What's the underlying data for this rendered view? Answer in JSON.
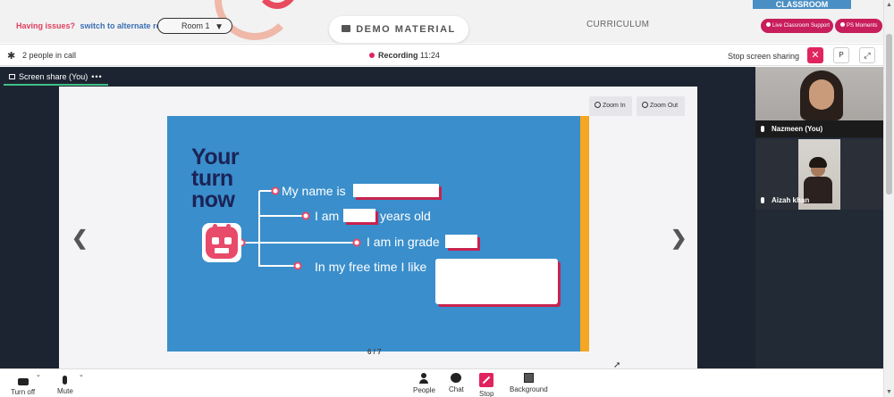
{
  "header": {
    "issues_text": "Having issues?",
    "switch_link": "switch to alternate room",
    "room_select": "Room 1",
    "demo_material": "DEMO MATERIAL",
    "curriculum": "CURRICULUM",
    "classroom_tab": "CLASSROOM",
    "live_support": "Live Classroom Support",
    "ps_moments": "PS Moments"
  },
  "callbar": {
    "people_count": "2 people in call",
    "recording_label": "Recording",
    "recording_time": "11:24",
    "stop_sharing": "Stop screen sharing",
    "p_button": "P"
  },
  "stage": {
    "share_tab": "Screen share (You)",
    "share_tab_more": "•••",
    "zoom_in": "Zoom In",
    "zoom_out": "Zoom Out",
    "slide_counter": "6 / 7"
  },
  "slide": {
    "title_line1": "Your",
    "title_line2": "turn",
    "title_line3": "now",
    "prompt_name": "My name is",
    "prompt_age_before": "I am",
    "prompt_age_after": "years old",
    "prompt_grade": "I am in grade",
    "prompt_free_time": "In my free time I like"
  },
  "participants": [
    {
      "name": "Nazmeen (You)"
    },
    {
      "name": "Aizah khan"
    }
  ],
  "toolbar": {
    "turn_off": "Turn off",
    "mute": "Mute",
    "people": "People",
    "chat": "Chat",
    "stop": "Stop",
    "background": "Background"
  },
  "colors": {
    "accent_pink": "#e0245e",
    "slide_blue": "#3a8ecb",
    "slide_orange": "#f5a623",
    "title_navy": "#1b2356",
    "stage_dark": "#1c2431"
  }
}
